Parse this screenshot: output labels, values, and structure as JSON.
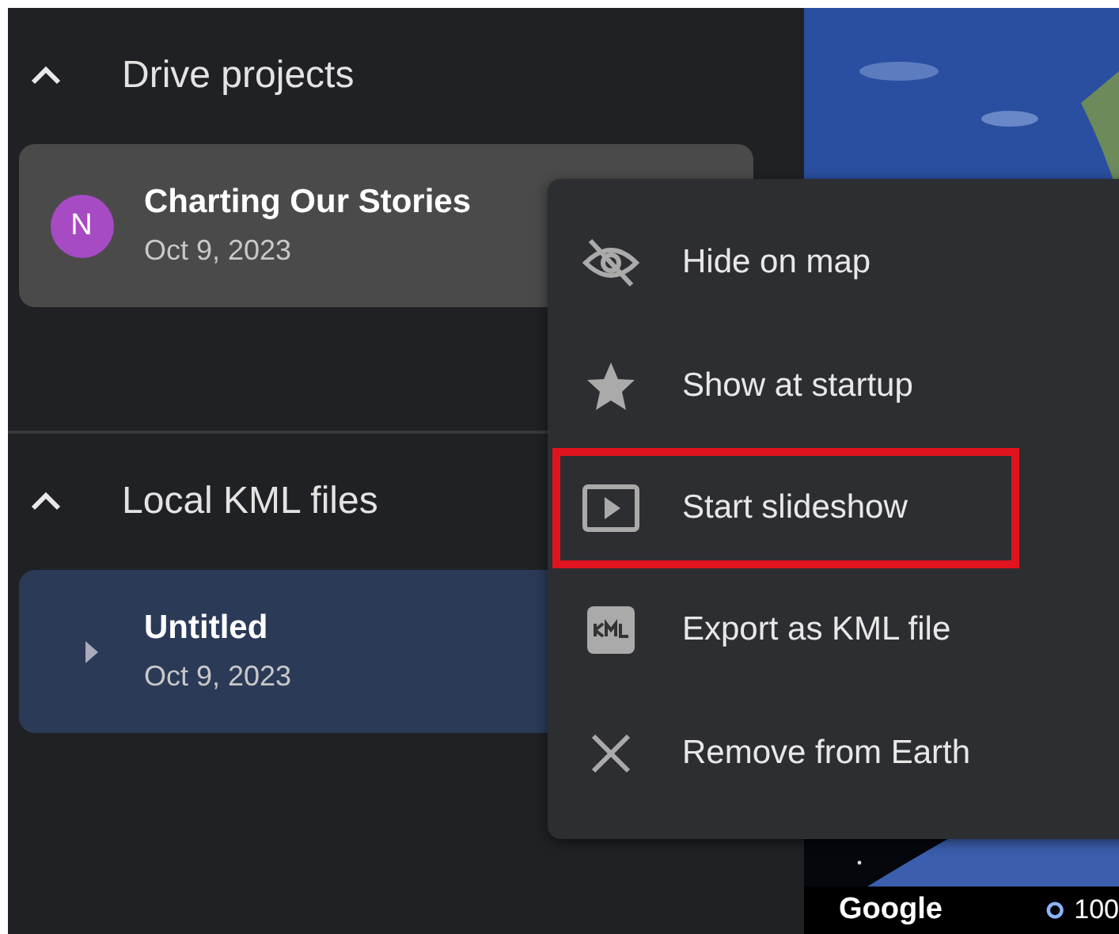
{
  "sections": [
    {
      "title": "Drive projects",
      "expanded": true,
      "items": [
        {
          "kind": "project",
          "avatar": "N",
          "color": "#a64bc3",
          "title": "Charting Our Stories",
          "date": "Oct 9, 2023",
          "selected": false
        }
      ]
    },
    {
      "title": "Local KML files",
      "expanded": true,
      "items": [
        {
          "kind": "file",
          "title": "Untitled",
          "date": "Oct 9, 2023",
          "selected": true
        }
      ]
    }
  ],
  "context_menu": {
    "items": [
      {
        "kind": "hide",
        "label": "Hide on map",
        "highlighted": false
      },
      {
        "kind": "star",
        "label": "Show at startup",
        "highlighted": false
      },
      {
        "kind": "play",
        "label": "Start slideshow",
        "highlighted": true
      },
      {
        "kind": "kml",
        "label": "Export as KML file",
        "highlighted": false
      },
      {
        "kind": "close",
        "label": "Remove from Earth",
        "highlighted": false
      }
    ]
  },
  "map": {
    "logo": "Google",
    "scale": "100"
  }
}
